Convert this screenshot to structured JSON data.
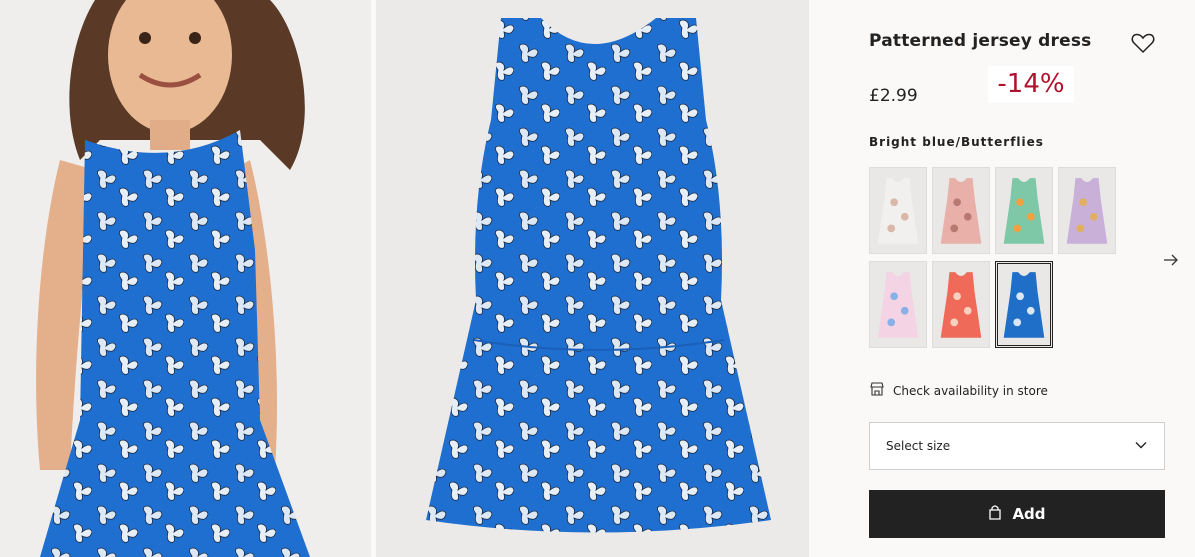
{
  "images": {
    "model_photo": {
      "alt": "girl wearing blue butterfly dress"
    },
    "flat_photo": {
      "alt": "blue butterfly dress"
    }
  },
  "product": {
    "title": "Patterned jersey dress",
    "price": "£2.99",
    "discount": "-14%",
    "discount_color": "#b0122e",
    "favourite_icon": "heart-outline-icon",
    "color_name": "Bright blue/Butterflies",
    "swatches": [
      {
        "color": "#f2f0ee",
        "pattern": "#d9b8a8"
      },
      {
        "color": "#e8b0a8",
        "pattern": "#b87a70"
      },
      {
        "color": "#7ec8a8",
        "pattern": "#f0a040"
      },
      {
        "color": "#c8b0d8",
        "pattern": "#e0b060"
      },
      {
        "color": "#f4d4e4",
        "pattern": "#8ab0e8"
      },
      {
        "color": "#f06a5a",
        "pattern": "#f8d0c0"
      },
      {
        "color": "#1f6fc8",
        "pattern": "#d8e6f6"
      }
    ],
    "selected_swatch": 6,
    "next_icon": "arrow-right-icon",
    "store_icon": "store-icon",
    "store_label": "Check availability in store",
    "size_select": {
      "label": "Select size",
      "icon": "chevron-down-icon"
    },
    "add_button": {
      "label": "Add",
      "icon": "bag-icon",
      "bg": "#222222"
    }
  }
}
